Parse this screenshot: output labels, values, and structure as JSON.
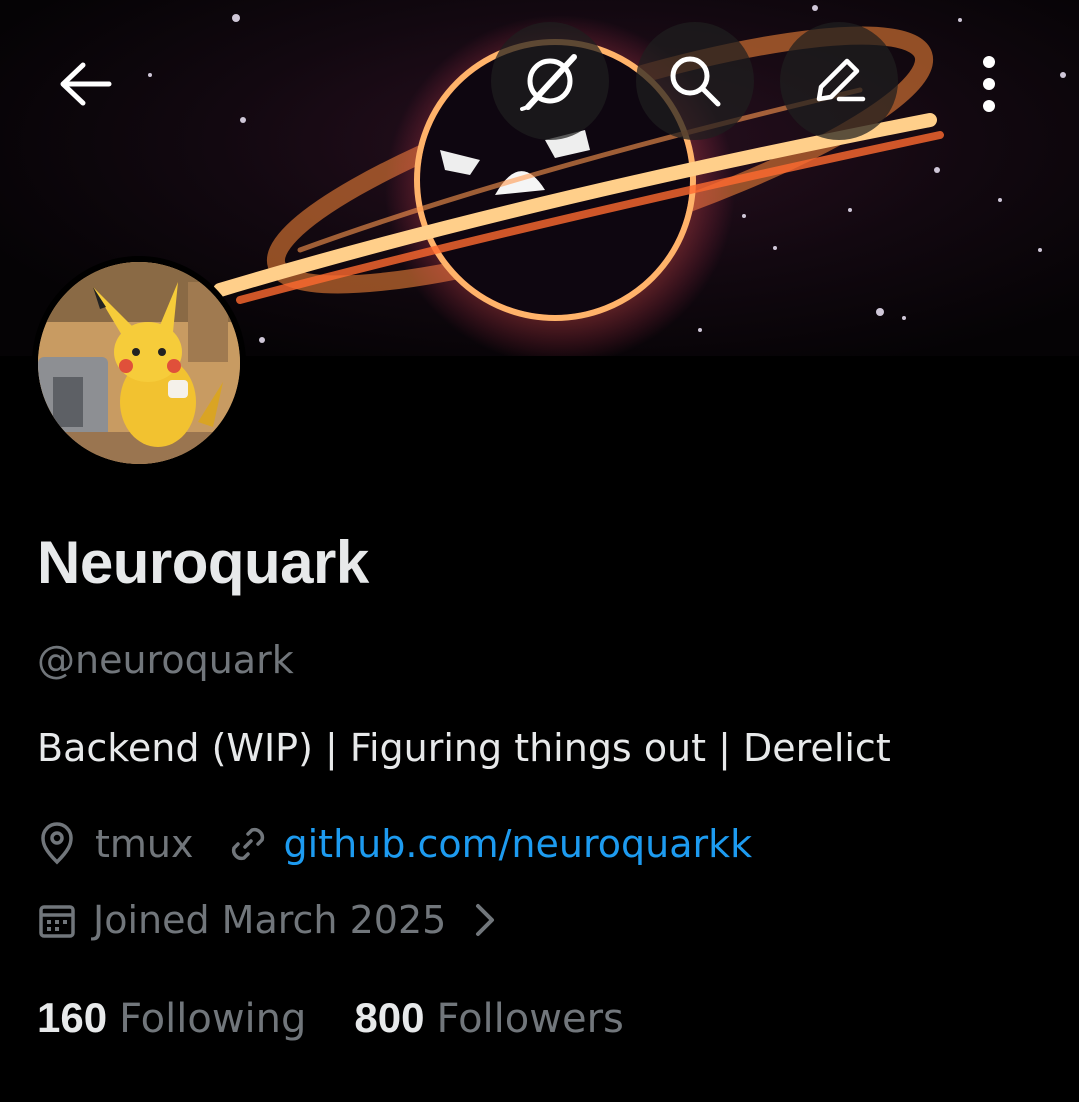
{
  "profile": {
    "name": "Neuroquark",
    "handle": "@neuroquark",
    "bio": "Backend (WIP) | Figuring things out | Derelict",
    "location": "tmux",
    "website": "github.com/neuroquarkk",
    "joined": "Joined March 2025"
  },
  "stats": {
    "following_count": "160",
    "following_label": "Following",
    "followers_count": "800",
    "followers_label": "Followers"
  },
  "icons": {
    "back": "back-arrow-icon",
    "grok": "grok-icon",
    "search": "search-icon",
    "edit": "edit-icon",
    "more": "more-vertical-icon",
    "location": "location-pin-icon",
    "link": "link-icon",
    "calendar": "calendar-icon",
    "chevron": "chevron-right-icon"
  },
  "colors": {
    "background": "#000000",
    "text_primary": "#e7e9ea",
    "text_secondary": "#71767b",
    "link": "#1d9bf0"
  }
}
